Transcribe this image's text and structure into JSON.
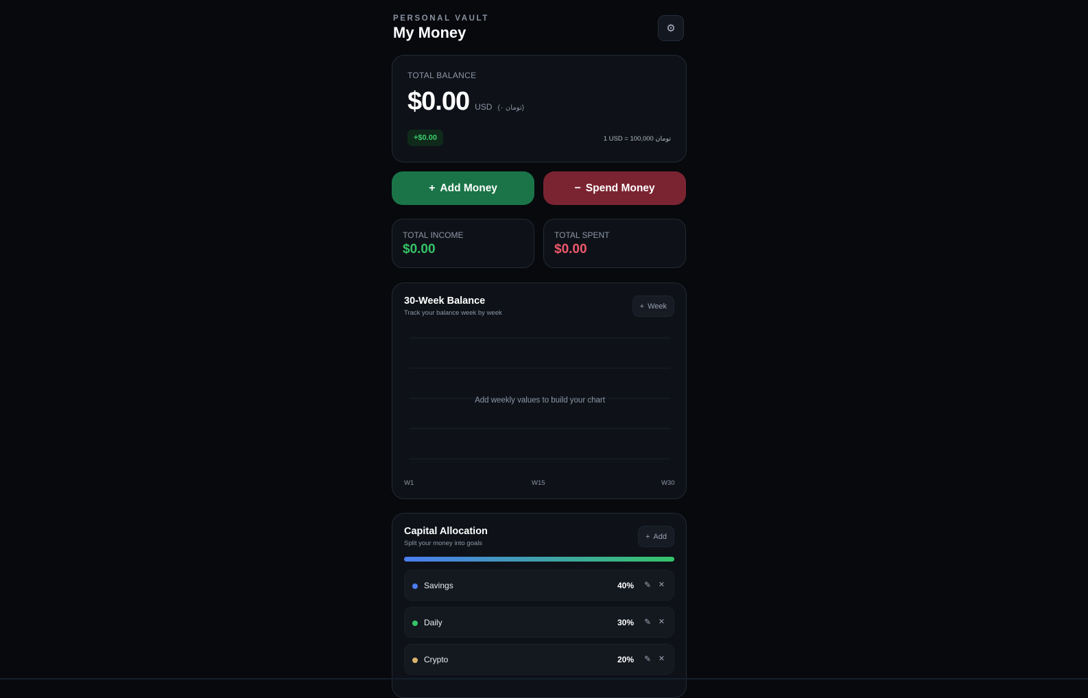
{
  "header": {
    "eyebrow": "PERSONAL VAULT",
    "title": "My Money",
    "settings_icon": "gear-icon"
  },
  "balance": {
    "label": "TOTAL BALANCE",
    "amount": "$0.00",
    "currency": "USD",
    "toman": "(۰ تومان)",
    "delta": "+$0.00",
    "rate": "1 USD = 100,000 تومان"
  },
  "actions": {
    "add": {
      "symbol": "+",
      "label": "Add Money"
    },
    "spend": {
      "symbol": "−",
      "label": "Spend Money"
    }
  },
  "stats": {
    "income_label": "TOTAL INCOME",
    "income_value": "$0.00",
    "spent_label": "TOTAL SPENT",
    "spent_value": "$0.00"
  },
  "weekly_chart": {
    "title": "30-Week Balance",
    "subtitle": "Track your balance week by week",
    "add_button": {
      "symbol": "+",
      "label": "Week"
    },
    "empty_message": "Add weekly values to build your chart",
    "ticks": [
      "W1",
      "W15",
      "W30"
    ]
  },
  "allocation": {
    "title": "Capital Allocation",
    "subtitle": "Split your money into goals",
    "add_button": {
      "symbol": "+",
      "label": "Add"
    },
    "gradient_colors": [
      "#4b7df0",
      "#35c469"
    ],
    "items": [
      {
        "name": "Savings",
        "percent": "40%",
        "color": "#4b7df0",
        "edit_icon": "pencil-icon",
        "delete_icon": "close-icon"
      },
      {
        "name": "Daily",
        "percent": "30%",
        "color": "#35c468",
        "edit_icon": "pencil-icon",
        "delete_icon": "close-icon"
      },
      {
        "name": "Crypto",
        "percent": "20%",
        "color": "#d9b36a",
        "edit_icon": "pencil-icon",
        "delete_icon": "close-icon"
      }
    ]
  }
}
